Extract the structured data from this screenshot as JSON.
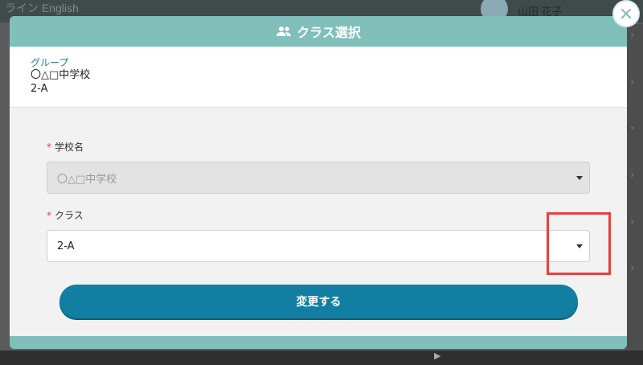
{
  "background": {
    "top_text": "ライン English",
    "user_name": "山田 花子",
    "bottom_hint": "▶"
  },
  "modal": {
    "title": "クラス選択",
    "group": {
      "label": "グループ",
      "school": "〇△□中学校",
      "class": "2-A"
    },
    "school_field": {
      "label": "学校名",
      "required_mark": "*",
      "value": "〇△□中学校"
    },
    "class_field": {
      "label": "クラス",
      "required_mark": "*",
      "value": "2-A"
    },
    "submit_label": "変更する",
    "close_label": "×"
  },
  "colors": {
    "header": "#80bfba",
    "button": "#127fa2",
    "highlight": "#e8403f",
    "group_label": "#1e7fa0"
  }
}
